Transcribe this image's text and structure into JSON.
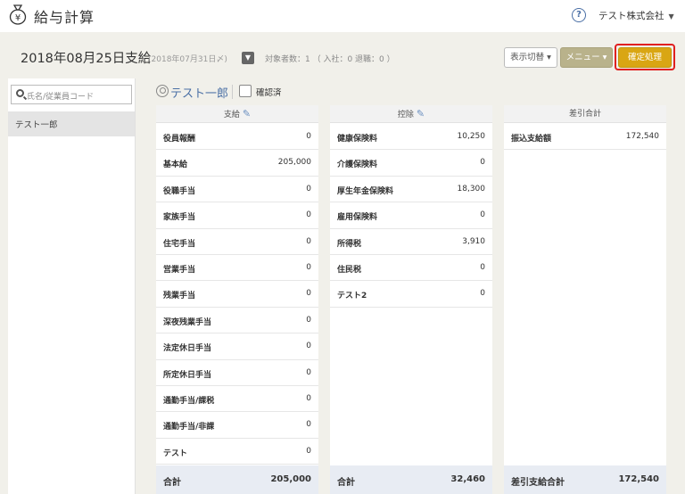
{
  "header": {
    "title": "給与計算",
    "help_icon": "?",
    "company": "テスト株式会社",
    "company_caret": "▼"
  },
  "period": {
    "title": "2018年08月25日支給",
    "sub": "(2018年07月31日〆)",
    "count": "対象者数：1 （ 入社：0  退職：0 ）",
    "dropdown_caret": "▼"
  },
  "buttons": {
    "view": "表示切替 ▾",
    "menu": "メニュー ▾",
    "confirm": "確定処理"
  },
  "search": {
    "placeholder": "氏名/従業員コード"
  },
  "employees": [
    "テスト一郎"
  ],
  "employee_header": {
    "name": "テスト一郎",
    "confirmed_label": "確認済"
  },
  "columns": {
    "payments": {
      "title": "支給",
      "rows": [
        {
          "label": "役員報酬",
          "value": "0"
        },
        {
          "label": "基本給",
          "value": "205,000"
        },
        {
          "label": "役職手当",
          "value": "0"
        },
        {
          "label": "家族手当",
          "value": "0"
        },
        {
          "label": "住宅手当",
          "value": "0"
        },
        {
          "label": "営業手当",
          "value": "0"
        },
        {
          "label": "残業手当",
          "value": "0"
        },
        {
          "label": "深夜残業手当",
          "value": "0"
        },
        {
          "label": "法定休日手当",
          "value": "0"
        },
        {
          "label": "所定休日手当",
          "value": "0"
        },
        {
          "label": "通勤手当/課税",
          "value": "0"
        },
        {
          "label": "通勤手当/非課",
          "value": "0"
        },
        {
          "label": "テスト",
          "value": "0"
        }
      ],
      "total_label": "合計",
      "total_value": "205,000"
    },
    "deductions": {
      "title": "控除",
      "rows": [
        {
          "label": "健康保険料",
          "value": "10,250"
        },
        {
          "label": "介護保険料",
          "value": "0"
        },
        {
          "label": "厚生年金保険料",
          "value": "18,300"
        },
        {
          "label": "雇用保険料",
          "value": "0"
        },
        {
          "label": "所得税",
          "value": "3,910"
        },
        {
          "label": "住民税",
          "value": "0"
        },
        {
          "label": "テスト2",
          "value": "0"
        }
      ],
      "total_label": "合計",
      "total_value": "32,460"
    },
    "net": {
      "title": "差引合計",
      "rows": [
        {
          "label": "振込支給額",
          "value": "172,540"
        }
      ],
      "total_label": "差引支給合計",
      "total_value": "172,540"
    }
  }
}
